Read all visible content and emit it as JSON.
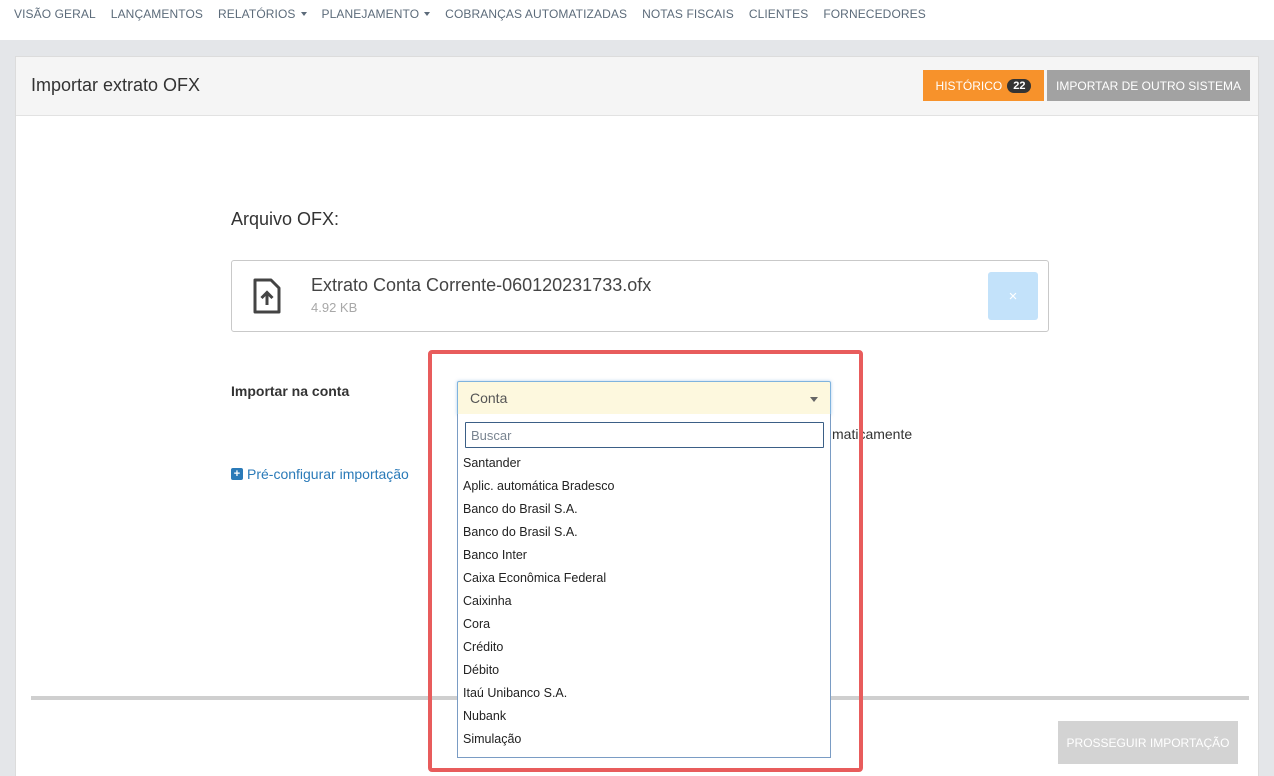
{
  "nav": {
    "items": [
      {
        "label": "VISÃO GERAL",
        "dropdown": false
      },
      {
        "label": "LANÇAMENTOS",
        "dropdown": false
      },
      {
        "label": "RELATÓRIOS",
        "dropdown": true
      },
      {
        "label": "PLANEJAMENTO",
        "dropdown": true
      },
      {
        "label": "COBRANÇAS AUTOMATIZADAS",
        "dropdown": false
      },
      {
        "label": "NOTAS FISCAIS",
        "dropdown": false
      },
      {
        "label": "CLIENTES",
        "dropdown": false
      },
      {
        "label": "FORNECEDORES",
        "dropdown": false
      }
    ]
  },
  "header": {
    "title": "Importar extrato OFX",
    "history_label": "HISTÓRICO",
    "history_count": "22",
    "import_other_label": "IMPORTAR DE OUTRO SISTEMA"
  },
  "file": {
    "section_title": "Arquivo OFX:",
    "name": "Extrato Conta Corrente-060120231733.ofx",
    "size": "4.92 KB",
    "remove_label": "×",
    "icon": "file-upload-icon"
  },
  "form": {
    "account_label": "Importar na conta",
    "auto_text_visible": "maticamente",
    "preconfig_label": "Pré-configurar importação",
    "proceed_label": "PROSSEGUIR IMPORTAÇÃO"
  },
  "select": {
    "value": "Conta",
    "search_placeholder": "Buscar",
    "options": [
      "Santander",
      "Aplic. automática Bradesco",
      "Banco do Brasil S.A.",
      "Banco do Brasil S.A.",
      "Banco Inter",
      "Caixa Econômica Federal",
      "Caixinha",
      "Cora",
      "Crédito",
      "Débito",
      "Itaú Unibanco S.A.",
      "Nubank",
      "Simulação"
    ]
  },
  "colors": {
    "history_button": "#f7922b",
    "highlight": "#e85c5c",
    "link": "#2a7ab8"
  }
}
